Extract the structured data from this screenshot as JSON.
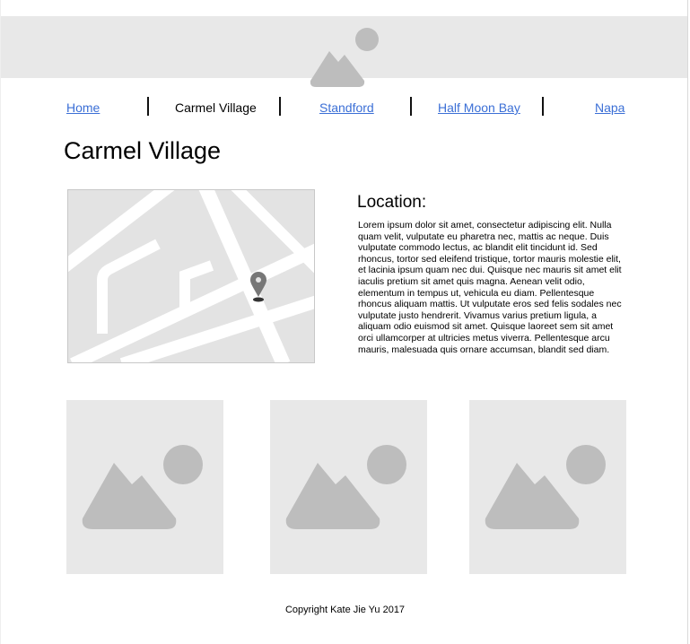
{
  "header": {
    "banner_icon": "image-placeholder-icon"
  },
  "nav": {
    "items": [
      {
        "label": "Home",
        "active": false
      },
      {
        "label": "Carmel Village",
        "active": true
      },
      {
        "label": "Standford",
        "active": false
      },
      {
        "label": "Half Moon Bay",
        "active": false
      },
      {
        "label": "Napa",
        "active": false
      }
    ],
    "link_color": "#3b6fd6"
  },
  "page": {
    "title": "Carmel Village"
  },
  "location": {
    "map_icon": "map-pin-icon",
    "heading": "Location:",
    "body": "Lorem ipsum dolor sit amet, consectetur adipiscing elit. Nulla quam velit, vulputate eu pharetra nec, mattis ac neque. Duis vulputate commodo lectus, ac blandit elit tincidunt id. Sed rhoncus, tortor sed eleifend tristique, tortor mauris molestie elit, et lacinia ipsum quam nec dui. Quisque nec mauris sit amet elit iaculis pretium sit amet quis magna. Aenean velit odio, elementum in tempus ut, vehicula eu diam. Pellentesque rhoncus aliquam mattis. Ut vulputate eros sed felis sodales nec vulputate justo hendrerit. Vivamus varius pretium ligula, a aliquam odio euismod sit amet. Quisque laoreet sem sit amet orci ullamcorper at ultricies metus viverra. Pellentesque arcu mauris, malesuada quis ornare accumsan, blandit sed diam."
  },
  "gallery": {
    "thumbnails": [
      {
        "icon": "image-placeholder-icon"
      },
      {
        "icon": "image-placeholder-icon"
      },
      {
        "icon": "image-placeholder-icon"
      }
    ]
  },
  "footer": {
    "copyright": "Copyright Kate Jie Yu 2017"
  }
}
